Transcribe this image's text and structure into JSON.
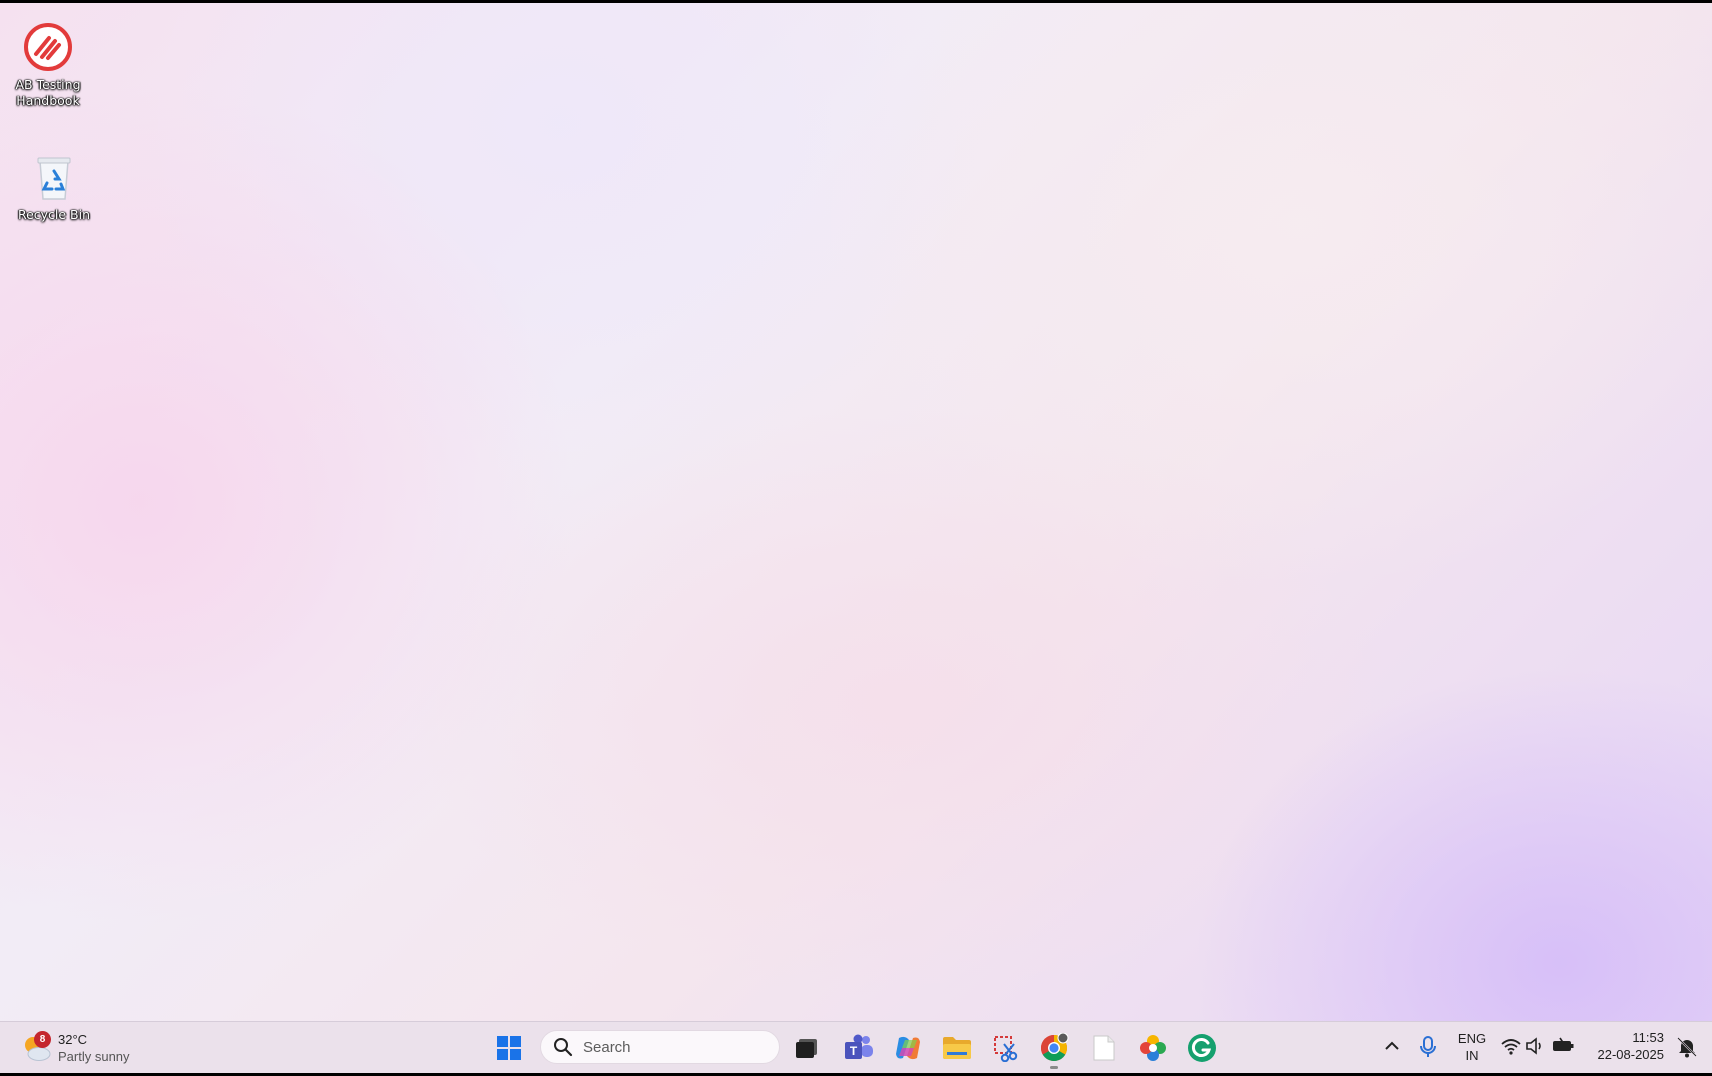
{
  "desktop": {
    "icons": [
      {
        "label": "AB Testing Handbook",
        "icon": "ab-testing-handbook-icon"
      },
      {
        "label": "Recycle Bin",
        "icon": "recycle-bin-icon"
      }
    ]
  },
  "taskbar": {
    "weather": {
      "temperature": "32°C",
      "condition": "Partly sunny",
      "badge": "8"
    },
    "search": {
      "placeholder": "Search"
    },
    "apps": [
      {
        "name": "Start",
        "icon": "windows-start-icon"
      },
      {
        "name": "Task View",
        "icon": "task-view-icon"
      },
      {
        "name": "Microsoft Teams",
        "icon": "teams-icon"
      },
      {
        "name": "Copilot",
        "icon": "copilot-icon"
      },
      {
        "name": "File Explorer",
        "icon": "file-explorer-icon"
      },
      {
        "name": "Snipping Tool",
        "icon": "snipping-tool-icon"
      },
      {
        "name": "Google Chrome",
        "icon": "chrome-icon"
      },
      {
        "name": "Notepad",
        "icon": "notepad-icon"
      },
      {
        "name": "Photos",
        "icon": "photos-icon"
      },
      {
        "name": "Grammarly",
        "icon": "grammarly-icon"
      }
    ],
    "tray": {
      "language_line1": "ENG",
      "language_line2": "IN",
      "time": "11:53",
      "date": "22-08-2025"
    }
  },
  "colors": {
    "accent_blue": "#1a73e8",
    "badge_red": "#c4262e",
    "ab_icon_red": "#e23b3b"
  }
}
